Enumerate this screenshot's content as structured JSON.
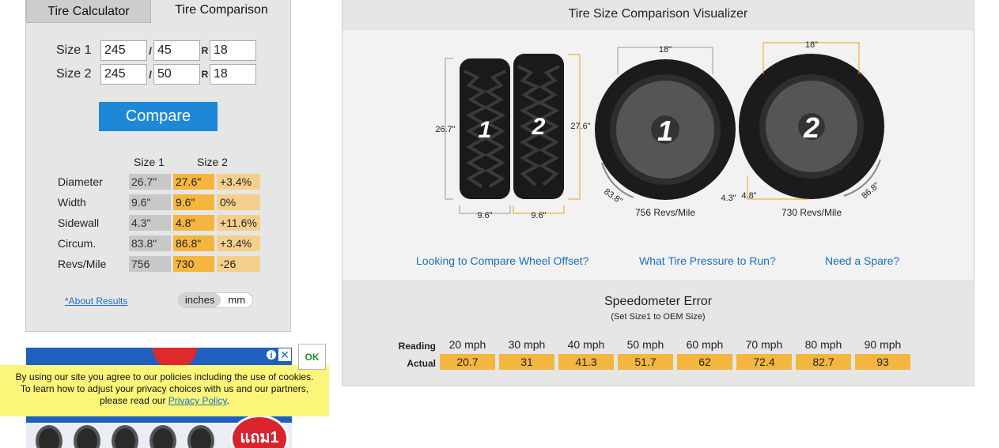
{
  "tabs": {
    "calculator": "Tire Calculator",
    "comparison": "Tire Comparison"
  },
  "sizes": [
    {
      "label": "Size 1",
      "width": "245",
      "aspect": "45",
      "rim": "18"
    },
    {
      "label": "Size 2",
      "width": "245",
      "aspect": "50",
      "rim": "18"
    }
  ],
  "separators": {
    "slash": "/",
    "r": "R"
  },
  "compare_button": "Compare",
  "results": {
    "headers": [
      "Size 1",
      "Size 2"
    ],
    "rows": [
      {
        "label": "Diameter",
        "s1": "26.7\"",
        "s2": "27.6\"",
        "diff": "+3.4%"
      },
      {
        "label": "Width",
        "s1": "9.6\"",
        "s2": "9.6\"",
        "diff": "0%"
      },
      {
        "label": "Sidewall",
        "s1": "4.3\"",
        "s2": "4.8\"",
        "diff": "+11.6%"
      },
      {
        "label": "Circum.",
        "s1": "83.8\"",
        "s2": "86.8\"",
        "diff": "+3.4%"
      },
      {
        "label": "Revs/Mile",
        "s1": "756",
        "s2": "730",
        "diff": "-26"
      }
    ]
  },
  "about_link": "*About Results",
  "units": {
    "inches": "inches",
    "mm": "mm",
    "selected": "inches"
  },
  "visualizer": {
    "title": "Tire Size Comparison Visualizer",
    "tread_labels": [
      "1",
      "2"
    ],
    "tread_heights": [
      "26.7\"",
      "27.6\""
    ],
    "tread_widths": [
      "9.6\"",
      "9.6\""
    ],
    "wheel_rims": [
      "18\"",
      "18\""
    ],
    "wheel_sidewalls": [
      "4.3\"",
      "4.8\""
    ],
    "wheel_circums": [
      "83.8\"",
      "86.8\""
    ],
    "wheel_revs": [
      "756 Revs/Mile",
      "730 Revs/Mile"
    ],
    "links": [
      "Looking to Compare Wheel Offset?",
      "What Tire Pressure to Run?",
      "Need a Spare?"
    ]
  },
  "speedometer": {
    "title": "Speedometer Error",
    "subtitle": "(Set Size1 to OEM Size)",
    "reading_label": "Reading",
    "actual_label": "Actual",
    "readings": [
      "20 mph",
      "30 mph",
      "40 mph",
      "50 mph",
      "60 mph",
      "70 mph",
      "80 mph",
      "90 mph"
    ],
    "actuals": [
      "20.7",
      "31",
      "41.3",
      "51.7",
      "62",
      "72.4",
      "82.7",
      "93"
    ]
  },
  "cookie": {
    "line1": "By using our site you agree to our policies including the use of cookies.",
    "line2": "To learn how to adjust your privacy choices with us and our partners,",
    "line3_prefix": "please read our ",
    "privacy_link": "Privacy Policy",
    "line3_suffix": ".",
    "ok": "OK"
  },
  "ad": {
    "badge_text": "แถม1"
  },
  "colors": {
    "accent": "#1e88d8",
    "size2": "#f4b63e",
    "diff": "#f5d08c",
    "size1": "#c8c8c8",
    "link": "#1a6fc0",
    "cookie_bg": "#fbf67a"
  }
}
